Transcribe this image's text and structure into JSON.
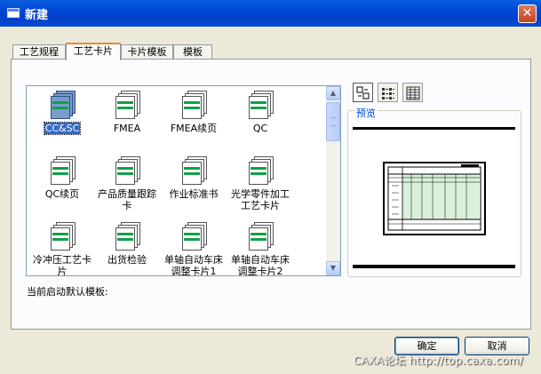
{
  "window": {
    "title": "新建",
    "close_glyph": "✕"
  },
  "tabs": [
    {
      "label": "工艺规程",
      "active": false
    },
    {
      "label": "工艺卡片",
      "active": true
    },
    {
      "label": "卡片模板",
      "active": false
    },
    {
      "label": "模板",
      "active": false
    }
  ],
  "templates": {
    "items": [
      {
        "label": "CC&SC",
        "selected": true,
        "icon": "template-file-icon"
      },
      {
        "label": "FMEA",
        "selected": false,
        "icon": "template-file-icon"
      },
      {
        "label": "FMEA续页",
        "selected": false,
        "icon": "template-file-icon"
      },
      {
        "label": "QC",
        "selected": false,
        "icon": "template-file-icon"
      },
      {
        "label": "QC续页",
        "selected": false,
        "icon": "template-file-icon"
      },
      {
        "label": "产品质量跟踪卡",
        "selected": false,
        "icon": "template-file-icon"
      },
      {
        "label": "作业标准书",
        "selected": false,
        "icon": "template-file-icon"
      },
      {
        "label": "光学零件加工工艺卡片",
        "selected": false,
        "icon": "template-file-icon"
      },
      {
        "label": "冷冲压工艺卡片",
        "selected": false,
        "icon": "template-file-icon"
      },
      {
        "label": "出货检验",
        "selected": false,
        "icon": "template-file-icon"
      },
      {
        "label": "单轴自动车床调整卡片1",
        "selected": false,
        "icon": "template-file-icon"
      },
      {
        "label": "单轴自动车床调整卡片2",
        "selected": false,
        "icon": "template-file-icon"
      }
    ],
    "scroll_up_glyph": "▲",
    "scroll_down_glyph": "▼"
  },
  "status": {
    "label": "当前启动默认模板:"
  },
  "view_modes": [
    {
      "icon": "large-icons-view-icon",
      "active": true
    },
    {
      "icon": "list-view-icon",
      "active": false
    },
    {
      "icon": "details-view-icon",
      "active": false
    }
  ],
  "preview": {
    "label": "预览",
    "icon": "card-template-thumbnail"
  },
  "buttons": {
    "ok": "确定",
    "cancel": "取消"
  },
  "watermark": "CAXA论坛 http://top.caxa.com/",
  "colors": {
    "titlebar": "#0046d5",
    "selection": "#316ac5",
    "active_tab_accent": "#e68b2c",
    "icon_green": "#12a04a",
    "preview_label": "#0046d5"
  }
}
